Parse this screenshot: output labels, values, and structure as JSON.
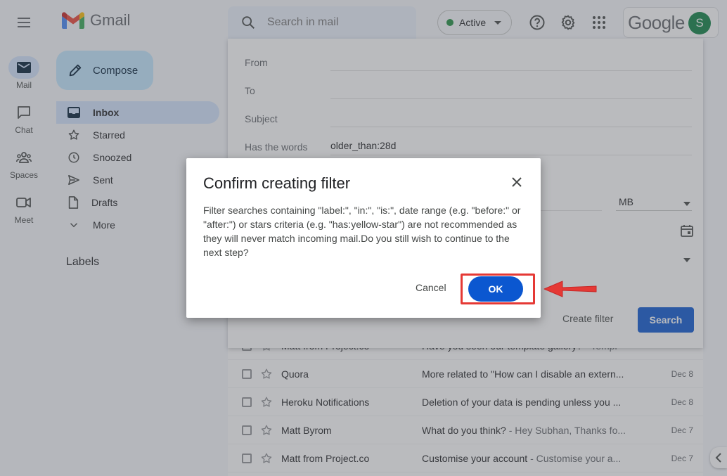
{
  "app": {
    "name": "Gmail"
  },
  "header": {
    "search_placeholder": "Search in mail",
    "status_label": "Active",
    "google_word": "Google",
    "avatar_letter": "S"
  },
  "rail": [
    {
      "label": "Mail",
      "icon": "mail-icon"
    },
    {
      "label": "Chat",
      "icon": "chat-icon"
    },
    {
      "label": "Spaces",
      "icon": "spaces-icon"
    },
    {
      "label": "Meet",
      "icon": "meet-icon"
    }
  ],
  "nav": {
    "compose_label": "Compose",
    "items": [
      {
        "label": "Inbox",
        "icon": "inbox-icon"
      },
      {
        "label": "Starred",
        "icon": "star-icon"
      },
      {
        "label": "Snoozed",
        "icon": "clock-icon"
      },
      {
        "label": "Sent",
        "icon": "send-icon"
      },
      {
        "label": "Drafts",
        "icon": "draft-icon"
      },
      {
        "label": "More",
        "icon": "chevron-down-icon"
      }
    ],
    "labels_heading": "Labels"
  },
  "search_options": {
    "fields": [
      {
        "label": "From",
        "value": ""
      },
      {
        "label": "To",
        "value": ""
      },
      {
        "label": "Subject",
        "value": ""
      },
      {
        "label": "Has the words",
        "value": "older_than:28d"
      }
    ],
    "size_unit": "MB",
    "create_filter_label": "Create filter",
    "search_button_label": "Search"
  },
  "mail_rows": [
    {
      "sender": "Matt from Project.co",
      "subject": "Have you seen our template gallery?",
      "snippet": " - Templ",
      "date": ""
    },
    {
      "sender": "Quora",
      "subject": "More related to \"How can I disable an extern...",
      "snippet": "",
      "date": "Dec 8"
    },
    {
      "sender": "Heroku Notifications",
      "subject": "Deletion of your data is pending unless you ...",
      "snippet": "",
      "date": "Dec 8"
    },
    {
      "sender": "Matt Byrom",
      "subject": "What do you think?",
      "snippet": " - Hey Subhan, Thanks fo...",
      "date": "Dec 7"
    },
    {
      "sender": "Matt from Project.co",
      "subject": "Customise your account",
      "snippet": " - Customise your a...",
      "date": "Dec 7"
    }
  ],
  "dialog": {
    "title": "Confirm creating filter",
    "body": "Filter searches containing \"label:\", \"in:\", \"is:\", date range (e.g. \"before:\" or \"after:\") or stars criteria (e.g. \"has:yellow-star\") are not recommended as they will never match incoming mail.Do you still wish to continue to the next step?",
    "cancel_label": "Cancel",
    "ok_label": "OK"
  },
  "colors": {
    "accent": "#0b57d0",
    "compose_bg": "#c2e7ff",
    "active_nav": "#d3e3fd",
    "highlight": "#e53935"
  }
}
